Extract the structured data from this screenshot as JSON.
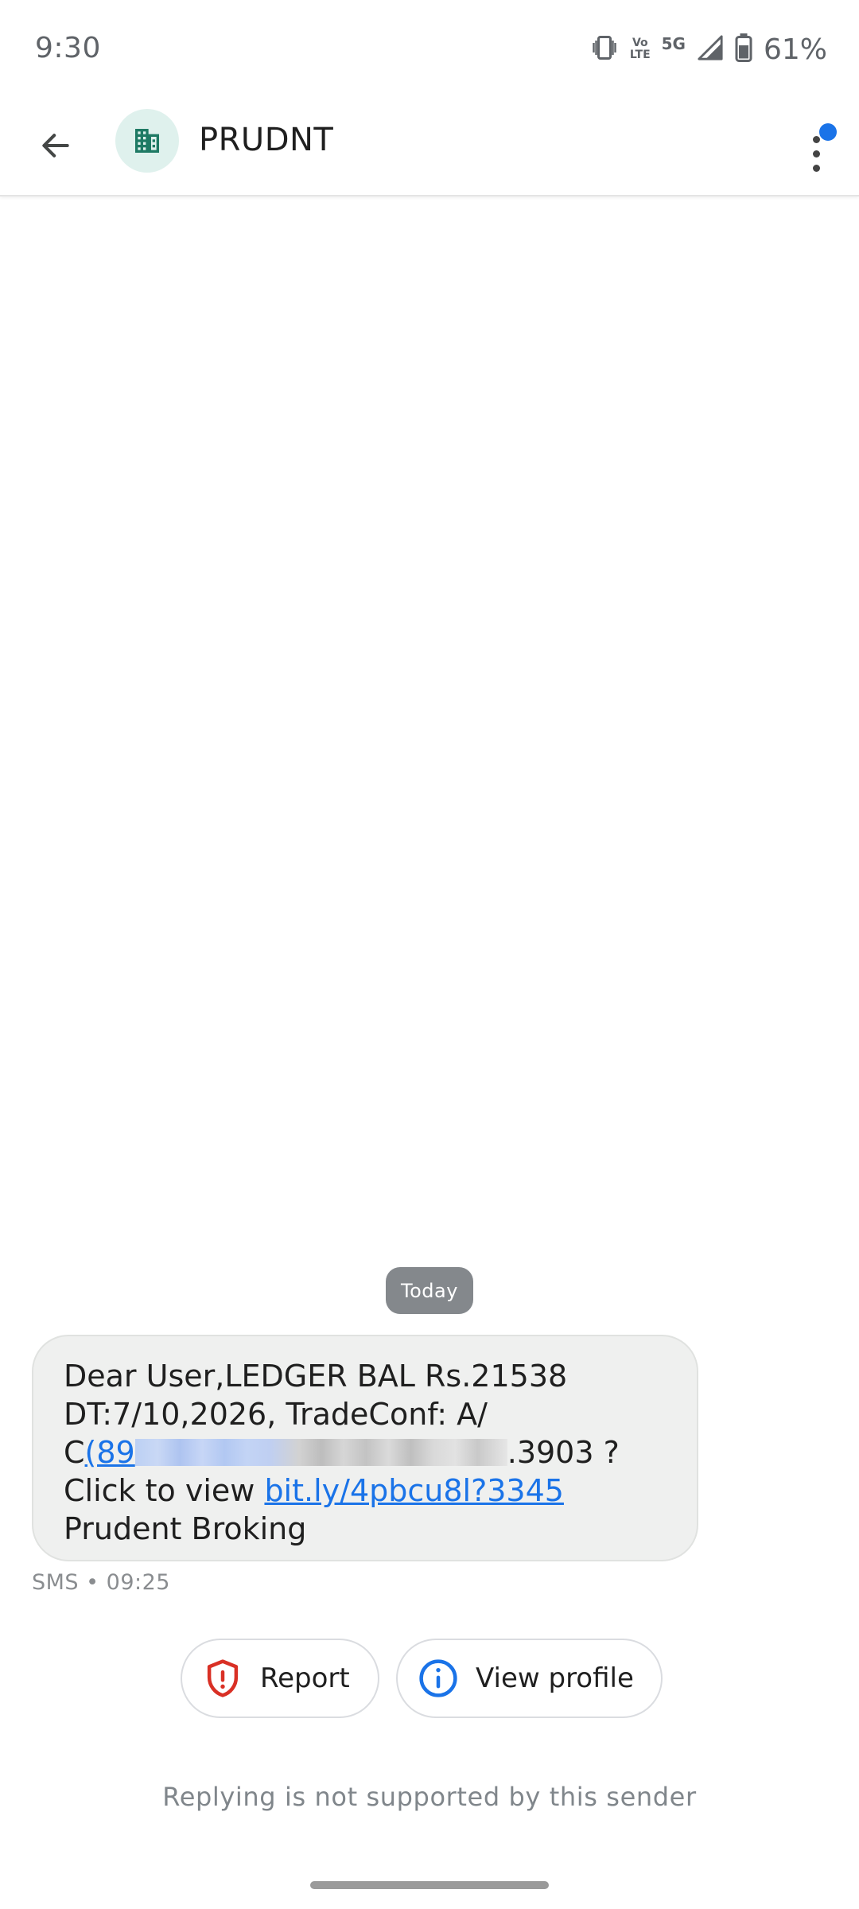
{
  "status_bar": {
    "time": "9:30",
    "network_volte_line1": "Vo",
    "network_volte_line2": "LTE",
    "network_type": "5G",
    "battery_percent": "61%"
  },
  "app_bar": {
    "sender_name": "PRUDNT",
    "notification_color": "#1a73e8",
    "avatar_bg": "#dff1ed",
    "avatar_icon_color": "#1e7a64"
  },
  "conversation": {
    "date_chip": "Today",
    "message": {
      "line1": "Dear User,LEDGER BAL Rs.21538",
      "line2": "DT:7/10,2026, TradeConf: A/",
      "line3_prefix": "C",
      "line3_link": "(89",
      "line3_suffix": ".3903 ?",
      "line4_prefix": "Click to view ",
      "line4_link": "bit.ly/4pbcu8l?3345",
      "line5": "Prudent Broking"
    },
    "meta": "SMS • 09:25"
  },
  "actions": {
    "report_label": "Report",
    "view_profile_label": "View profile"
  },
  "footer": {
    "reply_note": "Replying is not supported by this sender"
  },
  "colors": {
    "accent": "#1a73e8",
    "report_red": "#d93025",
    "bubble_bg": "#eff0ef"
  }
}
